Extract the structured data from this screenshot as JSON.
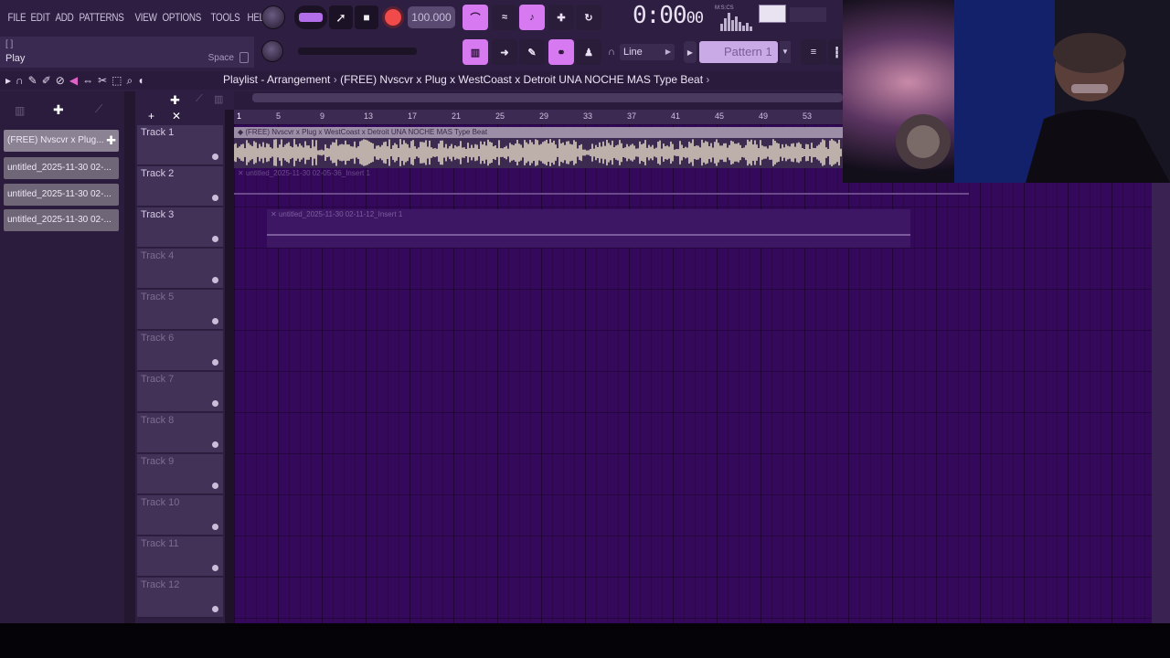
{
  "menu": [
    "FILE",
    "EDIT",
    "ADD",
    "PATTERNS",
    "VIEW",
    "OPTIONS",
    "TOOLS",
    "HELP"
  ],
  "hint": {
    "top": "[ ]",
    "label": "Play",
    "key": "Space"
  },
  "transport": {
    "tempo": "100.000",
    "time_main": "0:00",
    "time_sub": "00",
    "time_unit": "M:S:CS"
  },
  "toolbar": {
    "snap": "Line",
    "pattern": "Pattern 1"
  },
  "playlist": {
    "title": "Playlist - Arrangement",
    "project": "(FREE) Nvscvr x Plug x WestCoast x Detroit UNA NOCHE MAS  Type Beat"
  },
  "clips_list": [
    "(FREE) Nvscvr x Plug...",
    "untitled_2025-11-30 02-...",
    "untitled_2025-11-30 02-...",
    "untitled_2025-11-30 02-..."
  ],
  "ruler": [
    "1",
    "5",
    "9",
    "13",
    "17",
    "21",
    "25",
    "29",
    "33",
    "37",
    "41",
    "45",
    "49",
    "53"
  ],
  "tracks": [
    "Track 1",
    "Track 2",
    "Track 3",
    "Track 4",
    "Track 5",
    "Track 6",
    "Track 7",
    "Track 8",
    "Track 9",
    "Track 10",
    "Track 11",
    "Track 12"
  ],
  "arrangement_clips": [
    "(FREE) Nvscvr x Plug x WestCoast x Detroit UNA NOCHE MAS  Type Beat",
    "untitled_2025-11-30 02-05-36_Insert 1",
    "untitled_2025-11-30 02-11-12_Insert 1"
  ],
  "colors": {
    "accent": "#d779f0",
    "record": "#f04a4a",
    "grid": "#34085a",
    "waveform": "#e8dcc8"
  }
}
